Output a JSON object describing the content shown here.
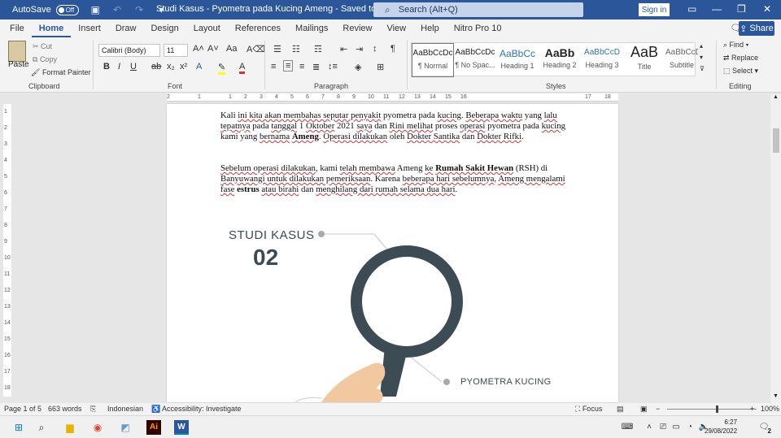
{
  "titlebar": {
    "autosave_label": "AutoSave",
    "autosave_state": "Off",
    "title": "Studi Kasus - Pyometra pada Kucing Ameng  -  Saved to this PC",
    "search_placeholder": "Search (Alt+Q)",
    "signin_label": "Sign in"
  },
  "tabs": [
    "File",
    "Home",
    "Insert",
    "Draw",
    "Design",
    "Layout",
    "References",
    "Mailings",
    "Review",
    "View",
    "Help",
    "Nitro Pro 10"
  ],
  "share_label": "Share",
  "ribbon": {
    "clipboard": {
      "paste": "Paste",
      "cut": "Cut",
      "copy": "Copy",
      "format_painter": "Format Painter",
      "label": "Clipboard"
    },
    "font": {
      "family": "Calibri (Body)",
      "size": "11",
      "label": "Font"
    },
    "paragraph": {
      "label": "Paragraph"
    },
    "styles": {
      "label": "Styles",
      "items": [
        {
          "sample": "AaBbCcDc",
          "name": "¶ Normal"
        },
        {
          "sample": "AaBbCcDc",
          "name": "¶ No Spac..."
        },
        {
          "sample": "AaBbCc",
          "name": "Heading 1"
        },
        {
          "sample": "AaBb",
          "name": "Heading 2"
        },
        {
          "sample": "AaBbCcD",
          "name": "Heading 3"
        },
        {
          "sample": "AaB",
          "name": "Title"
        },
        {
          "sample": "AaBbCcD",
          "name": "Subtitle"
        }
      ]
    },
    "editing": {
      "find": "Find",
      "replace": "Replace",
      "select": "Select",
      "label": "Editing"
    }
  },
  "ruler_marks": [
    "2",
    "1",
    "1",
    "2",
    "3",
    "4",
    "5",
    "6",
    "7",
    "8",
    "9",
    "10",
    "11",
    "12",
    "13",
    "14",
    "15",
    "16",
    "17",
    "18"
  ],
  "vruler_marks": [
    "1",
    "2",
    "3",
    "4",
    "5",
    "6",
    "7",
    "8",
    "9",
    "10",
    "11",
    "12",
    "13",
    "14",
    "15",
    "16",
    "17",
    "18"
  ],
  "document": {
    "p1": [
      {
        "t": "Kali ",
        "u": false
      },
      {
        "t": "ini kita akan membahas seputar penyakit",
        "u": true
      },
      {
        "t": " pyometra pada ",
        "u": false
      },
      {
        "t": "kucing",
        "u": true
      },
      {
        "t": ". ",
        "u": false
      },
      {
        "t": "Beberapa waktu",
        "u": true
      },
      {
        "t": " yang ",
        "u": false
      },
      {
        "t": "lalu tepatnya",
        "u": true
      },
      {
        "t": " pada ",
        "u": false
      },
      {
        "t": "tanggal",
        "u": true
      },
      {
        "t": " 1 ",
        "u": false
      },
      {
        "t": "Oktober",
        "u": true
      },
      {
        "t": " 2021 ",
        "u": false
      },
      {
        "t": "saya",
        "u": true
      },
      {
        "t": " dan ",
        "u": false
      },
      {
        "t": "Rini melihat",
        "u": true
      },
      {
        "t": " proses ",
        "u": false
      },
      {
        "t": "operasi",
        "u": true
      },
      {
        "t": " pyometra pada ",
        "u": false
      },
      {
        "t": "kucing",
        "u": true
      },
      {
        "t": " kami yang ",
        "u": false
      },
      {
        "t": "bernama",
        "u": true
      },
      {
        "t": " ",
        "u": false
      },
      {
        "t": "Ameng",
        "u": true,
        "b": true
      },
      {
        "t": ". ",
        "u": false
      },
      {
        "t": "Operasi dilakukan",
        "u": true
      },
      {
        "t": " oleh ",
        "u": false
      },
      {
        "t": "Dokter Santika",
        "u": true
      },
      {
        "t": " dan ",
        "u": false
      },
      {
        "t": "Dokter Rifki",
        "u": true
      },
      {
        "t": ".",
        "u": false
      }
    ],
    "p2": [
      {
        "t": "Sebelum operasi dilakukan",
        "u": true
      },
      {
        "t": ", kami ",
        "u": false
      },
      {
        "t": "telah membawa",
        "u": true
      },
      {
        "t": " Ameng ",
        "u": false
      },
      {
        "t": "ke",
        "u": true
      },
      {
        "t": " ",
        "u": false
      },
      {
        "t": "Rumah Sakit Hewan",
        "u": true,
        "b": true
      },
      {
        "t": " (RSH) di ",
        "u": false
      },
      {
        "t": "Banyuwangi untuk dilakukan pemeriksaan",
        "u": true
      },
      {
        "t": ". Karena ",
        "u": false
      },
      {
        "t": "beberapa hari sebelumnya",
        "u": true
      },
      {
        "t": ", ",
        "u": false
      },
      {
        "t": "Ameng mengalami fase",
        "u": true
      },
      {
        "t": " ",
        "u": false
      },
      {
        "t": "estrus",
        "u": false,
        "b": true
      },
      {
        "t": " ",
        "u": false
      },
      {
        "t": "atau birahi",
        "u": true
      },
      {
        "t": " dan ",
        "u": false
      },
      {
        "t": "menghilang dari rumah selama dua hari",
        "u": true
      },
      {
        "t": ".",
        "u": false
      }
    ],
    "infographic": {
      "title": "STUDI KASUS",
      "number": "02",
      "callout": "PYOMETRA KUCING",
      "colors": {
        "dark": "#3d4b55",
        "skin": "#f1c8a0",
        "gray": "#a7a9ab"
      }
    }
  },
  "status": {
    "page": "Page 1 of 5",
    "words": "663 words",
    "language": "Indonesian",
    "accessibility": "Accessibility: Investigate",
    "focus": "Focus",
    "zoom": "100%"
  },
  "taskbar": {
    "time": "6:27",
    "date": "29/08/2022",
    "notifications": "2"
  }
}
